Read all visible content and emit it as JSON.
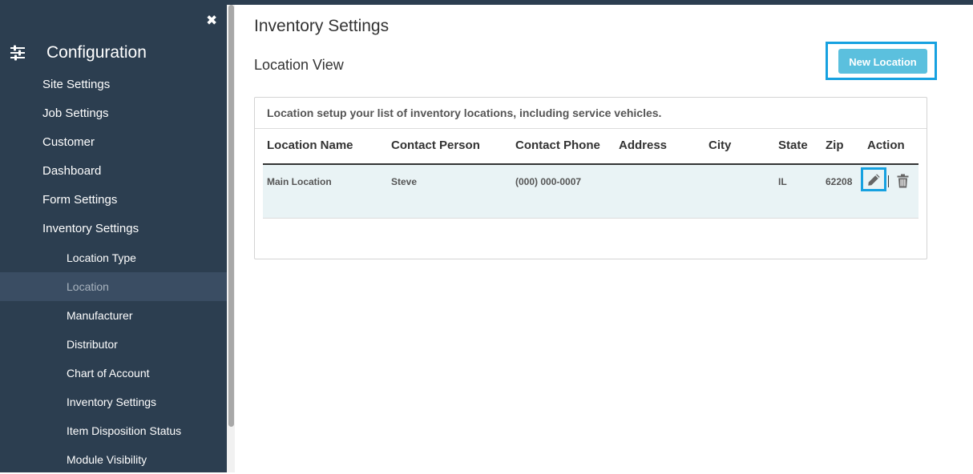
{
  "sidebar": {
    "title": "Configuration",
    "items": [
      {
        "label": "Site Settings"
      },
      {
        "label": "Job Settings"
      },
      {
        "label": "Customer"
      },
      {
        "label": "Dashboard"
      },
      {
        "label": "Form Settings"
      },
      {
        "label": "Inventory Settings"
      }
    ],
    "subitems": [
      {
        "label": "Location Type"
      },
      {
        "label": "Location",
        "active": true
      },
      {
        "label": "Manufacturer"
      },
      {
        "label": "Distributor"
      },
      {
        "label": "Chart of Account"
      },
      {
        "label": "Inventory Settings"
      },
      {
        "label": "Item Disposition Status"
      },
      {
        "label": "Module Visibility"
      }
    ]
  },
  "page": {
    "title": "Inventory Settings",
    "section_title": "Location View",
    "new_button": "New Location"
  },
  "panel": {
    "description": "Location setup your list of inventory locations, including service vehicles."
  },
  "table": {
    "headers": [
      "Location Name",
      "Contact Person",
      "Contact Phone",
      "Address",
      "City",
      "State",
      "Zip",
      "Action"
    ],
    "rows": [
      [
        "Main Location",
        "Steve",
        "(000) 000-0007",
        "",
        "",
        "IL",
        "62208"
      ]
    ]
  },
  "colors": {
    "sidebar_bg": "#2c3e50",
    "active_item_bg": "#3a4d63",
    "accent_button": "#5bc0de",
    "highlight_frame": "#16a1e0"
  }
}
